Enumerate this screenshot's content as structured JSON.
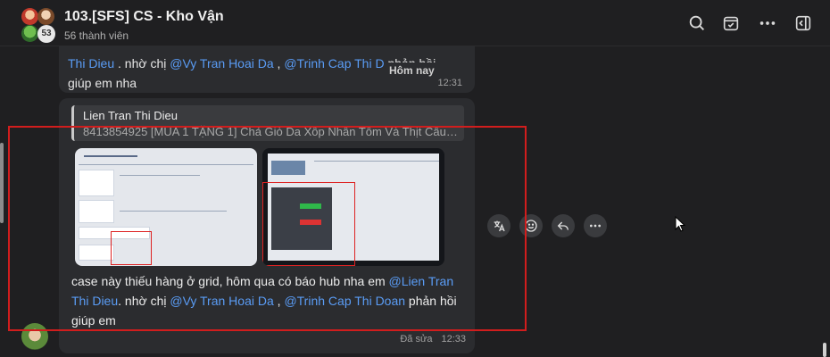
{
  "header": {
    "title": "103.[SFS] CS - Kho Vận",
    "subtitle": "56 thành viên",
    "avatar_count": "53"
  },
  "message1": {
    "parts": [
      {
        "text": "Thi Dieu",
        "mention": true
      },
      {
        "text": " . nhờ chị ",
        "mention": false
      },
      {
        "text": "@Vy Tran Hoai Da",
        "mention": true
      },
      {
        "text": " , ",
        "mention": false
      },
      {
        "text": "@Trinh Cap Thi D",
        "mention": true
      },
      {
        "text": " phản hồi giúp em nha",
        "mention": false
      }
    ],
    "time": "12:31"
  },
  "date_chip": "Hôm nay",
  "message2": {
    "quote": {
      "name": "Lien Tran Thi Dieu",
      "text": "8413854925 [MUA 1 TẶNG 1] Chả Giò Da Xốp Nhân Tôm Và Thịt Cầu ..."
    },
    "parts": [
      {
        "text": "case này thiếu hàng ở grid, hôm qua có báo hub nha em ",
        "mention": false
      },
      {
        "text": "@Lien Tran Thi Dieu",
        "mention": true
      },
      {
        "text": ". nhờ chị ",
        "mention": false
      },
      {
        "text": "@Vy Tran Hoai Da",
        "mention": true
      },
      {
        "text": " , ",
        "mention": false
      },
      {
        "text": "@Trinh Cap Thi Doan",
        "mention": true
      },
      {
        "text": " phản hồi giúp em",
        "mention": false
      }
    ],
    "edited_label": "Đã sửa",
    "time": "12:33"
  },
  "icons": {
    "header": [
      "search-icon",
      "calendar-check-icon",
      "more-icon",
      "sidebar-icon"
    ],
    "actions": [
      "translate-icon",
      "emoji-icon",
      "reply-icon",
      "more-icon"
    ]
  },
  "colors": {
    "background": "#1f1f21",
    "bubble": "#2b2c2f",
    "mention": "#5a9cf5",
    "highlight": "#d11d1d"
  }
}
